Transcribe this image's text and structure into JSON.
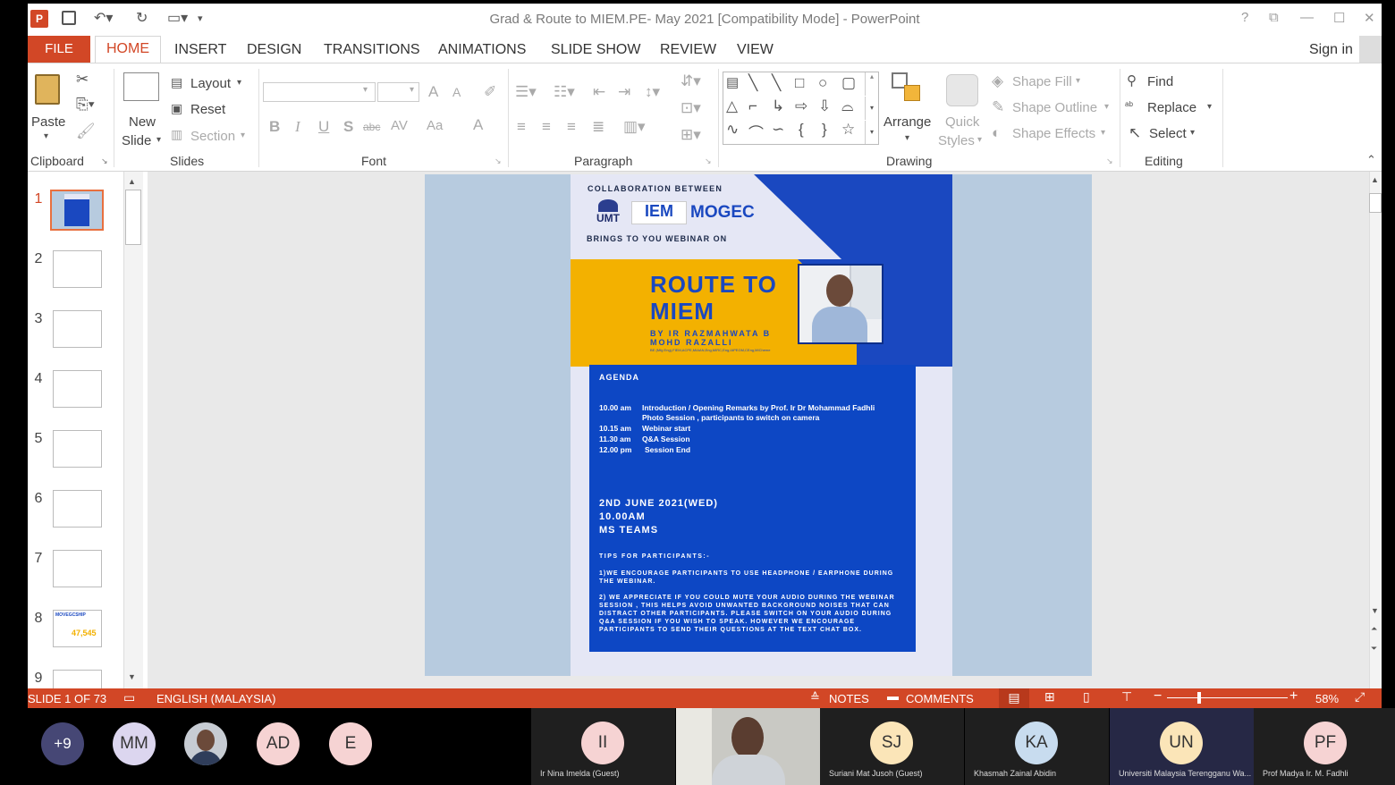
{
  "window": {
    "title": "Grad & Route to MIEM.PE- May 2021 [Compatibility Mode] - PowerPoint",
    "controls": [
      "?",
      "⧉",
      "—",
      "☐",
      "✕"
    ]
  },
  "tabs": [
    "FILE",
    "HOME",
    "INSERT",
    "DESIGN",
    "TRANSITIONS",
    "ANIMATIONS",
    "SLIDE SHOW",
    "REVIEW",
    "VIEW"
  ],
  "sign_in": "Sign in",
  "ribbon": {
    "clipboard": {
      "paste": "Paste",
      "label": "Clipboard"
    },
    "slides": {
      "new_slide_1": "New",
      "new_slide_2": "Slide",
      "layout": "Layout",
      "reset": "Reset",
      "section": "Section",
      "label": "Slides"
    },
    "font": {
      "label": "Font",
      "bold": "B",
      "italic": "I",
      "underline": "U",
      "shadow": "S",
      "strike": "abc",
      "spacing": "AV",
      "case": "Aa",
      "grow": "A",
      "shrink": "A",
      "color": "A"
    },
    "paragraph": {
      "label": "Paragraph"
    },
    "drawing": {
      "arrange": "Arrange",
      "quick_1": "Quick",
      "quick_2": "Styles",
      "shape_fill": "Shape Fill",
      "shape_outline": "Shape Outline",
      "shape_effects": "Shape Effects",
      "label": "Drawing"
    },
    "editing": {
      "find": "Find",
      "replace": "Replace",
      "select": "Select",
      "label": "Editing"
    }
  },
  "thumbnails": [
    "1",
    "2",
    "3",
    "4",
    "5",
    "6",
    "7",
    "8",
    "9"
  ],
  "thumb8_number": "47,545",
  "thumb8_title": "MOVEGCSHIP",
  "poster": {
    "collab": "COLLABORATION BETWEEN",
    "logos": [
      "UMT",
      "IEM",
      "MOGEC"
    ],
    "brings": "BRINGS TO YOU WEBINAR ON",
    "title_1": "ROUTE TO",
    "title_2": "MIEM",
    "by_1": "BY IR RAZMAHWATA B",
    "by_2": "MOHD RAZALLI",
    "creds": "BE (Mfg Eng),FIEM,ACPE,MIAAN,Eng,MIRC,Eng,IAPEGM,CEng,MICheme",
    "agenda_title": "AGENDA",
    "agenda": [
      {
        "time": "10.00 am",
        "text": "Introduction  / Opening Remarks by Prof. Ir Dr Mohammad Fadhli"
      },
      {
        "time": "",
        "text": "Photo Session , participants  to switch on camera"
      },
      {
        "time": "10.15 am",
        "text": "Webinar start"
      },
      {
        "time": "11.30 am",
        "text": "Q&A Session"
      },
      {
        "time": "12.00 pm",
        "text": "Session End"
      }
    ],
    "date": "2ND JUNE 2021(WED)",
    "time": "10.00AM",
    "platform": "MS TEAMS",
    "tips_title": "TIPS FOR PARTICIPANTS:-",
    "tip_1": "1)WE ENCOURAGE PARTICIPANTS TO USE HEADPHONE / EARPHONE DURING THE WEBINAR.",
    "tip_2": "2) WE APPRECIATE IF YOU COULD MUTE YOUR AUDIO DURING THE WEBINAR SESSION , THIS HELPS AVOID UNWANTED BACKGROUND NOISES THAT CAN DISTRACT OTHER PARTICIPANTS. PLEASE SWITCH ON YOUR AUDIO DURING Q&A SESSION IF YOU WISH TO SPEAK. HOWEVER WE ENCOURAGE PARTICIPANTS TO SEND THEIR QUESTIONS AT THE TEXT CHAT BOX."
  },
  "status": {
    "slide": "SLIDE 1 OF 73",
    "language": "ENGLISH (MALAYSIA)",
    "notes": "NOTES",
    "comments": "COMMENTS",
    "zoom": "58%"
  },
  "meeting": {
    "more": "+9",
    "avatars": [
      "MM",
      "AD",
      "E"
    ],
    "tiles": [
      {
        "initials": "II",
        "name": "Ir Nina Imelda (Guest)"
      },
      {
        "initials": "SJ",
        "name": "Suriani Mat Jusoh (Guest)"
      },
      {
        "initials": "KA",
        "name": "Khasmah Zainal Abidin"
      },
      {
        "initials": "UN",
        "name": "Universiti Malaysia Terengganu Wa..."
      },
      {
        "initials": "PF",
        "name": "Prof Madya Ir. M. Fadhli"
      }
    ]
  },
  "colors": {
    "accent": "#d24726",
    "poster_blue": "#0d47c4",
    "poster_yellow": "#f3b100"
  }
}
